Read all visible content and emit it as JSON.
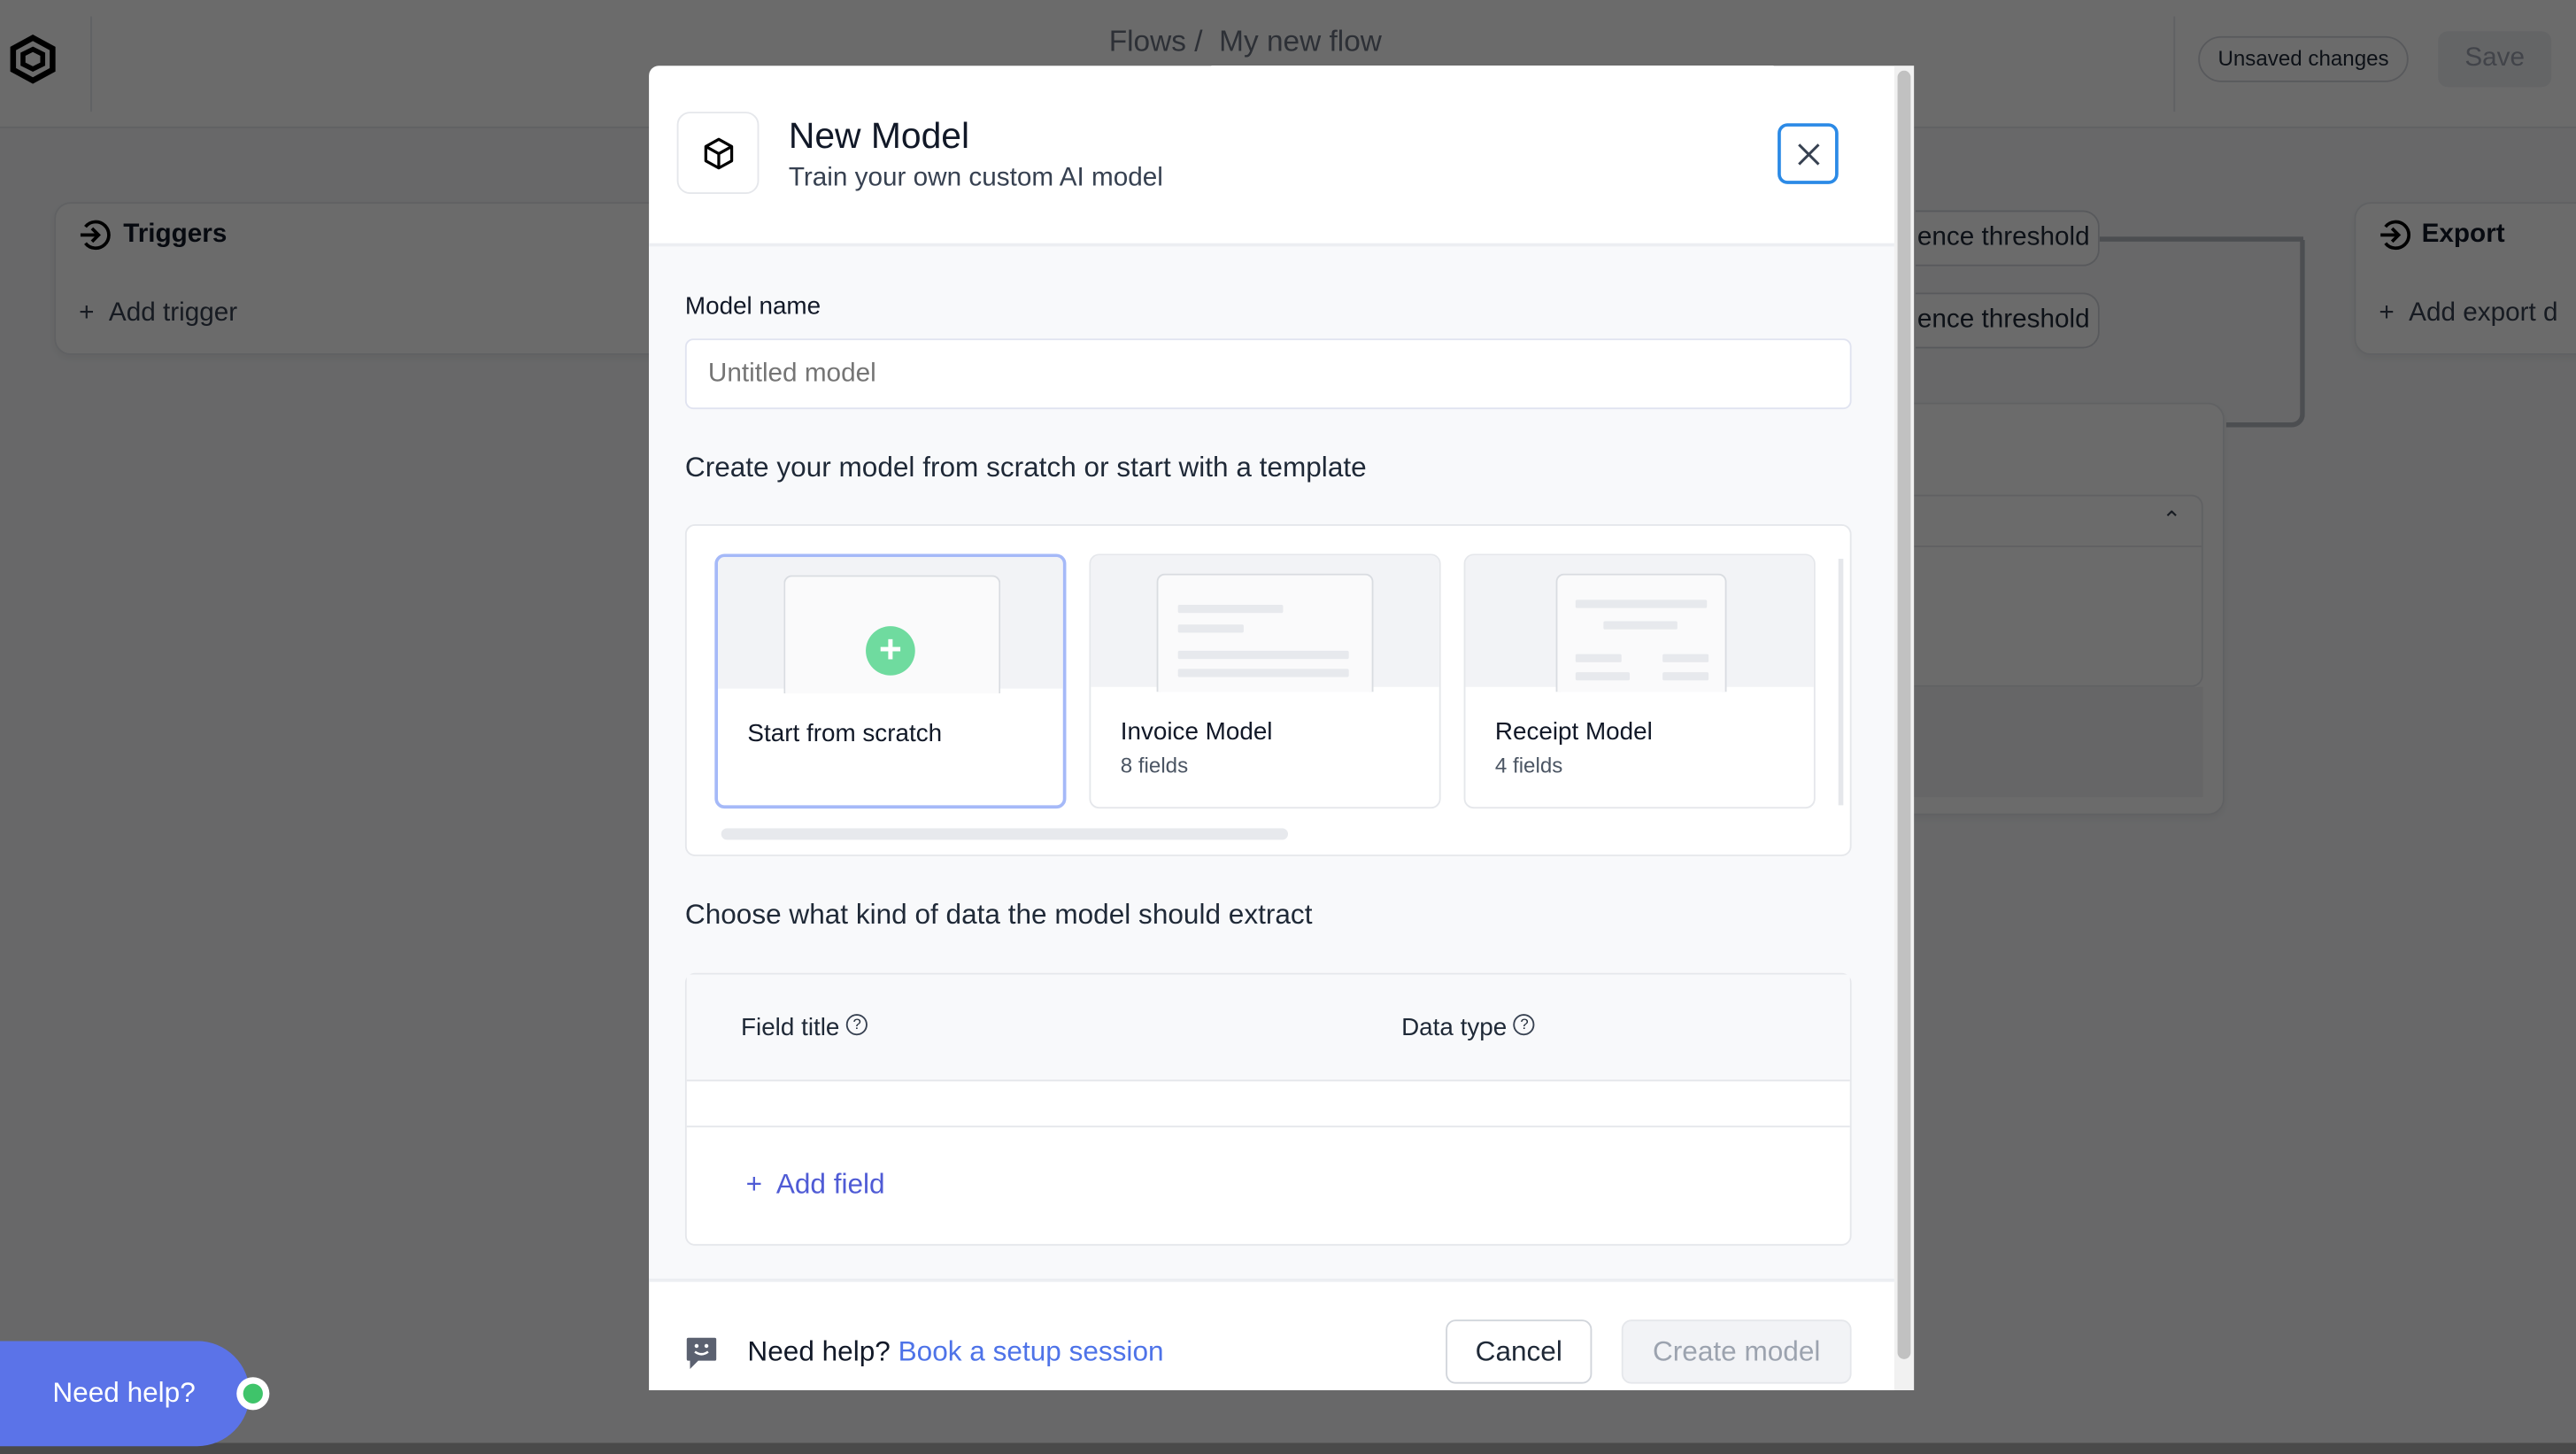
{
  "topbar": {
    "breadcrumb_parent": "Flows /",
    "breadcrumb_current": "My new flow",
    "status_badge": "Unsaved changes",
    "save_label": "Save"
  },
  "canvas": {
    "triggers_title": "Triggers",
    "add_trigger": "Add trigger",
    "threshold_1": "ence threshold",
    "threshold_2": "ence threshold",
    "export_title": "Export",
    "add_export": "Add export d"
  },
  "modal": {
    "title": "New Model",
    "subtitle": "Train your own custom AI model",
    "model_name_label": "Model name",
    "model_name_placeholder": "Untitled model",
    "model_name_value": "",
    "template_heading": "Create your model from scratch or start with a template",
    "templates": [
      {
        "title": "Start from scratch",
        "subtitle": ""
      },
      {
        "title": "Invoice Model",
        "subtitle": "8 fields"
      },
      {
        "title": "Receipt Model",
        "subtitle": "4 fields"
      }
    ],
    "fields_heading": "Choose what kind of data the model should extract",
    "columns": [
      "Field title",
      "Data type"
    ],
    "add_field": "Add field",
    "help_text": "Need help?",
    "help_link": "Book a setup session",
    "cancel_label": "Cancel",
    "create_label": "Create model"
  },
  "help_bubble": {
    "label": "Need help?"
  },
  "colors": {
    "accent": "#4f5bd5",
    "link": "#4e73e8",
    "close_border": "#2b8ae6",
    "selected_border": "#a5b9f8",
    "plus_green": "#6fdb9f",
    "online_dot": "#3fc46a",
    "help_bubble": "#5b73e8"
  }
}
